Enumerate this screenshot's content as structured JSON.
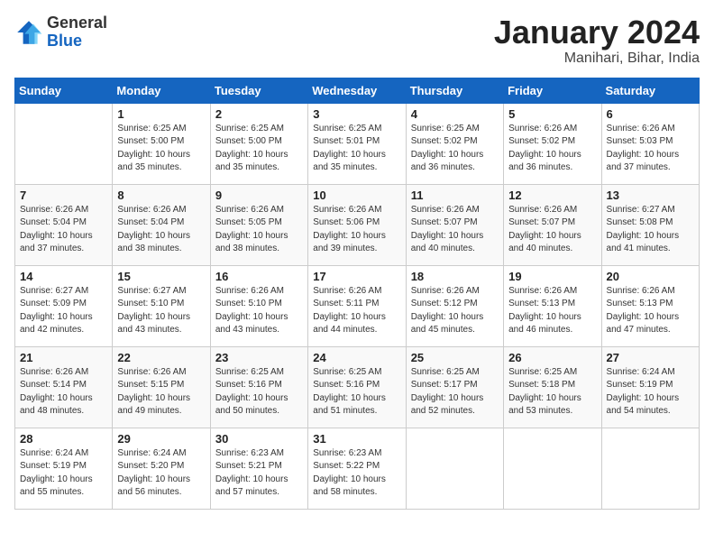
{
  "logo": {
    "general": "General",
    "blue": "Blue"
  },
  "title": "January 2024",
  "subtitle": "Manihari, Bihar, India",
  "days_header": [
    "Sunday",
    "Monday",
    "Tuesday",
    "Wednesday",
    "Thursday",
    "Friday",
    "Saturday"
  ],
  "weeks": [
    [
      {
        "day": "",
        "info": ""
      },
      {
        "day": "1",
        "info": "Sunrise: 6:25 AM\nSunset: 5:00 PM\nDaylight: 10 hours\nand 35 minutes."
      },
      {
        "day": "2",
        "info": "Sunrise: 6:25 AM\nSunset: 5:00 PM\nDaylight: 10 hours\nand 35 minutes."
      },
      {
        "day": "3",
        "info": "Sunrise: 6:25 AM\nSunset: 5:01 PM\nDaylight: 10 hours\nand 35 minutes."
      },
      {
        "day": "4",
        "info": "Sunrise: 6:25 AM\nSunset: 5:02 PM\nDaylight: 10 hours\nand 36 minutes."
      },
      {
        "day": "5",
        "info": "Sunrise: 6:26 AM\nSunset: 5:02 PM\nDaylight: 10 hours\nand 36 minutes."
      },
      {
        "day": "6",
        "info": "Sunrise: 6:26 AM\nSunset: 5:03 PM\nDaylight: 10 hours\nand 37 minutes."
      }
    ],
    [
      {
        "day": "7",
        "info": "Sunrise: 6:26 AM\nSunset: 5:04 PM\nDaylight: 10 hours\nand 37 minutes."
      },
      {
        "day": "8",
        "info": "Sunrise: 6:26 AM\nSunset: 5:04 PM\nDaylight: 10 hours\nand 38 minutes."
      },
      {
        "day": "9",
        "info": "Sunrise: 6:26 AM\nSunset: 5:05 PM\nDaylight: 10 hours\nand 38 minutes."
      },
      {
        "day": "10",
        "info": "Sunrise: 6:26 AM\nSunset: 5:06 PM\nDaylight: 10 hours\nand 39 minutes."
      },
      {
        "day": "11",
        "info": "Sunrise: 6:26 AM\nSunset: 5:07 PM\nDaylight: 10 hours\nand 40 minutes."
      },
      {
        "day": "12",
        "info": "Sunrise: 6:26 AM\nSunset: 5:07 PM\nDaylight: 10 hours\nand 40 minutes."
      },
      {
        "day": "13",
        "info": "Sunrise: 6:27 AM\nSunset: 5:08 PM\nDaylight: 10 hours\nand 41 minutes."
      }
    ],
    [
      {
        "day": "14",
        "info": "Sunrise: 6:27 AM\nSunset: 5:09 PM\nDaylight: 10 hours\nand 42 minutes."
      },
      {
        "day": "15",
        "info": "Sunrise: 6:27 AM\nSunset: 5:10 PM\nDaylight: 10 hours\nand 43 minutes."
      },
      {
        "day": "16",
        "info": "Sunrise: 6:26 AM\nSunset: 5:10 PM\nDaylight: 10 hours\nand 43 minutes."
      },
      {
        "day": "17",
        "info": "Sunrise: 6:26 AM\nSunset: 5:11 PM\nDaylight: 10 hours\nand 44 minutes."
      },
      {
        "day": "18",
        "info": "Sunrise: 6:26 AM\nSunset: 5:12 PM\nDaylight: 10 hours\nand 45 minutes."
      },
      {
        "day": "19",
        "info": "Sunrise: 6:26 AM\nSunset: 5:13 PM\nDaylight: 10 hours\nand 46 minutes."
      },
      {
        "day": "20",
        "info": "Sunrise: 6:26 AM\nSunset: 5:13 PM\nDaylight: 10 hours\nand 47 minutes."
      }
    ],
    [
      {
        "day": "21",
        "info": "Sunrise: 6:26 AM\nSunset: 5:14 PM\nDaylight: 10 hours\nand 48 minutes."
      },
      {
        "day": "22",
        "info": "Sunrise: 6:26 AM\nSunset: 5:15 PM\nDaylight: 10 hours\nand 49 minutes."
      },
      {
        "day": "23",
        "info": "Sunrise: 6:25 AM\nSunset: 5:16 PM\nDaylight: 10 hours\nand 50 minutes."
      },
      {
        "day": "24",
        "info": "Sunrise: 6:25 AM\nSunset: 5:16 PM\nDaylight: 10 hours\nand 51 minutes."
      },
      {
        "day": "25",
        "info": "Sunrise: 6:25 AM\nSunset: 5:17 PM\nDaylight: 10 hours\nand 52 minutes."
      },
      {
        "day": "26",
        "info": "Sunrise: 6:25 AM\nSunset: 5:18 PM\nDaylight: 10 hours\nand 53 minutes."
      },
      {
        "day": "27",
        "info": "Sunrise: 6:24 AM\nSunset: 5:19 PM\nDaylight: 10 hours\nand 54 minutes."
      }
    ],
    [
      {
        "day": "28",
        "info": "Sunrise: 6:24 AM\nSunset: 5:19 PM\nDaylight: 10 hours\nand 55 minutes."
      },
      {
        "day": "29",
        "info": "Sunrise: 6:24 AM\nSunset: 5:20 PM\nDaylight: 10 hours\nand 56 minutes."
      },
      {
        "day": "30",
        "info": "Sunrise: 6:23 AM\nSunset: 5:21 PM\nDaylight: 10 hours\nand 57 minutes."
      },
      {
        "day": "31",
        "info": "Sunrise: 6:23 AM\nSunset: 5:22 PM\nDaylight: 10 hours\nand 58 minutes."
      },
      {
        "day": "",
        "info": ""
      },
      {
        "day": "",
        "info": ""
      },
      {
        "day": "",
        "info": ""
      }
    ]
  ]
}
